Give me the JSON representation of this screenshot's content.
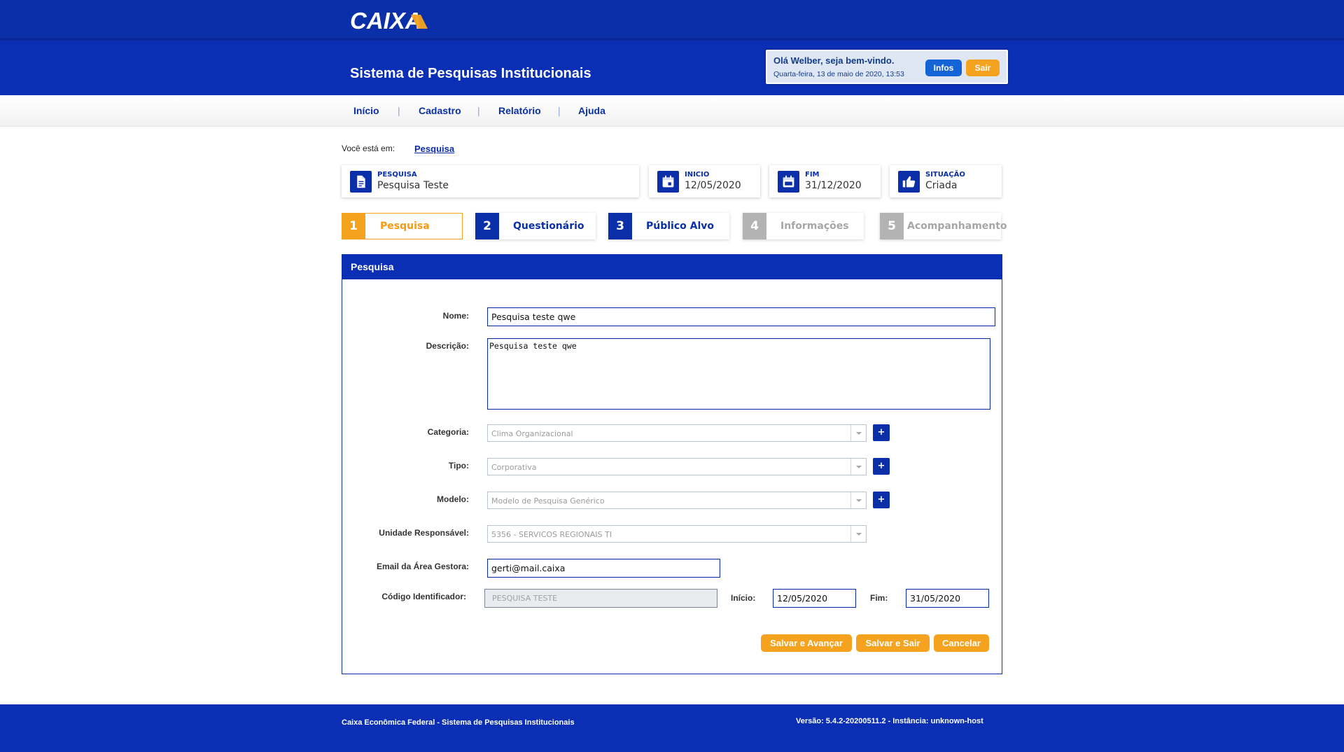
{
  "header": {
    "brand": "CAIXA",
    "system_title": "Sistema de Pesquisas Institucionais",
    "welcome_text": "Olá Welber, seja bem-vindo.",
    "date_text": "Quarta-feira, 13 de maio de 2020, 13:53",
    "infos_label": "Infos",
    "sair_label": "Sair"
  },
  "nav": {
    "items": [
      "Início",
      "Cadastro",
      "Relatório",
      "Ajuda"
    ],
    "separator": "|"
  },
  "breadcrumb": {
    "label": "Você está em:",
    "current": "Pesquisa"
  },
  "info_cards": [
    {
      "label": "PESQUISA",
      "value": "Pesquisa Teste",
      "icon": "document-icon"
    },
    {
      "label": "INICIO",
      "value": "12/05/2020",
      "icon": "calendar-icon"
    },
    {
      "label": "FIM",
      "value": "31/12/2020",
      "icon": "calendar-range-icon"
    },
    {
      "label": "SITUAÇÃO",
      "value": "Criada",
      "icon": "thumbs-up-icon"
    }
  ],
  "steps": [
    {
      "number": "1",
      "label": "Pesquisa",
      "state": "active"
    },
    {
      "number": "2",
      "label": "Questionário",
      "state": "done"
    },
    {
      "number": "3",
      "label": "Público Alvo",
      "state": "done"
    },
    {
      "number": "4",
      "label": "Informações",
      "state": "pending"
    },
    {
      "number": "5",
      "label": "Acompanhamento",
      "state": "pending"
    }
  ],
  "form": {
    "title": "Pesquisa",
    "nome_label": "Nome:",
    "nome_value": "Pesquisa teste qwe",
    "descricao_label": "Descrição:",
    "descricao_value": "Pesquisa teste qwe",
    "categoria_label": "Categoria:",
    "categoria_value": "Clima Organizacional",
    "tipo_label": "Tipo:",
    "tipo_value": "Corporativa",
    "modelo_label": "Modelo:",
    "modelo_value": "Modelo de Pesquisa Genérico",
    "unidade_label": "Unidade Responsável:",
    "unidade_value": "5356 - SERVICOS REGIONAIS TI",
    "email_label": "Email da Área Gestora:",
    "email_value": "gerti@mail.caixa",
    "codigo_label": "Código Identificador:",
    "codigo_value": "PESQUISA TESTE",
    "inicio_label": "Início:",
    "inicio_value": "12/05/2020",
    "fim_label": "Fim:",
    "fim_value": "31/05/2020",
    "plus_label": "+",
    "btn_salvar_avancar": "Salvar e Avançar",
    "btn_salvar_sair": "Salvar e Sair",
    "btn_cancelar": "Cancelar"
  },
  "footer": {
    "left": "Caixa Econômica Federal - Sistema de Pesquisas Institucionais",
    "right": "Versão: 5.4.2-20200511.2 - Instância: unknown-host"
  },
  "colors": {
    "brand_blue": "#0a2fb5",
    "accent_orange": "#f5a21f",
    "pending_gray": "#b3b3b3"
  }
}
